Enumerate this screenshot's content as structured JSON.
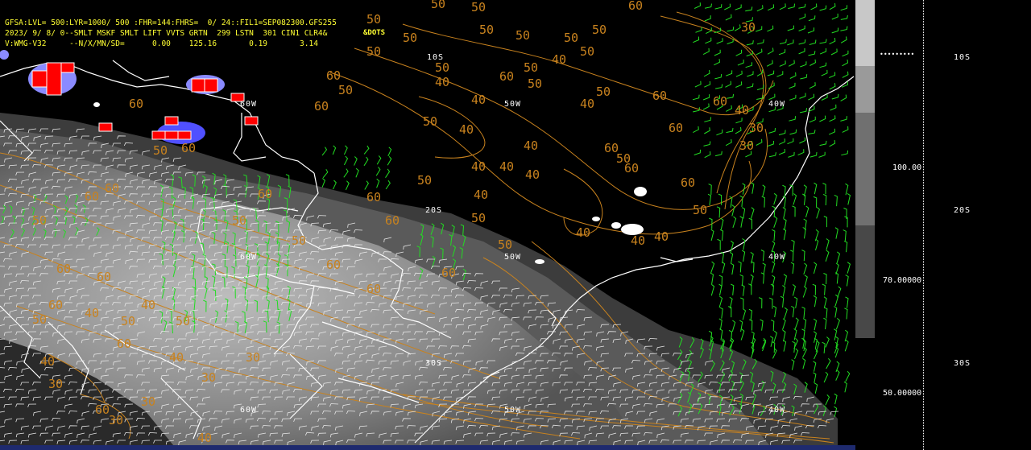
{
  "header": {
    "line1": "GFSA:LVL= 500:LYR=1000/ 500 :FHR=144:FHRS=  0/ 24::FIL1=SEP082300.GFS255",
    "line2": "2023/ 9/ 8/ 0--SMLT MSKF SMLT LIFT VVTS GRTN  299 LSTN  301 CIN1 CLR4&",
    "line3": "V:WMG-V32     --N/X/MN/SD=      0.00    125.16       0.19       3.14",
    "dots_label": "&DOTS"
  },
  "grid_labels": {
    "lat_10s": "10S",
    "lat_20s": "20S",
    "lat_30s": "30S",
    "lon_60w": "60W",
    "lon_50w": "50W",
    "lon_40w": "40W"
  },
  "contour_values": {
    "c30": "30",
    "c40": "40",
    "c50": "50",
    "c60": "60"
  },
  "scale": {
    "label_100": "100.00",
    "label_70": "70.00000",
    "label_50": "50.00000",
    "colors": [
      "#c8c8c8",
      "#9a9a9a",
      "#707070",
      "#484848"
    ]
  },
  "right_labels": {
    "lat_10s": "10S",
    "lat_20s": "20S",
    "lat_30s": "30S"
  },
  "colors": {
    "header_text": "#ffff33",
    "contour": "#c8821e",
    "wind_barbs": "#22dd22",
    "coastline": "#ffffff",
    "convection": "#ff0000"
  }
}
